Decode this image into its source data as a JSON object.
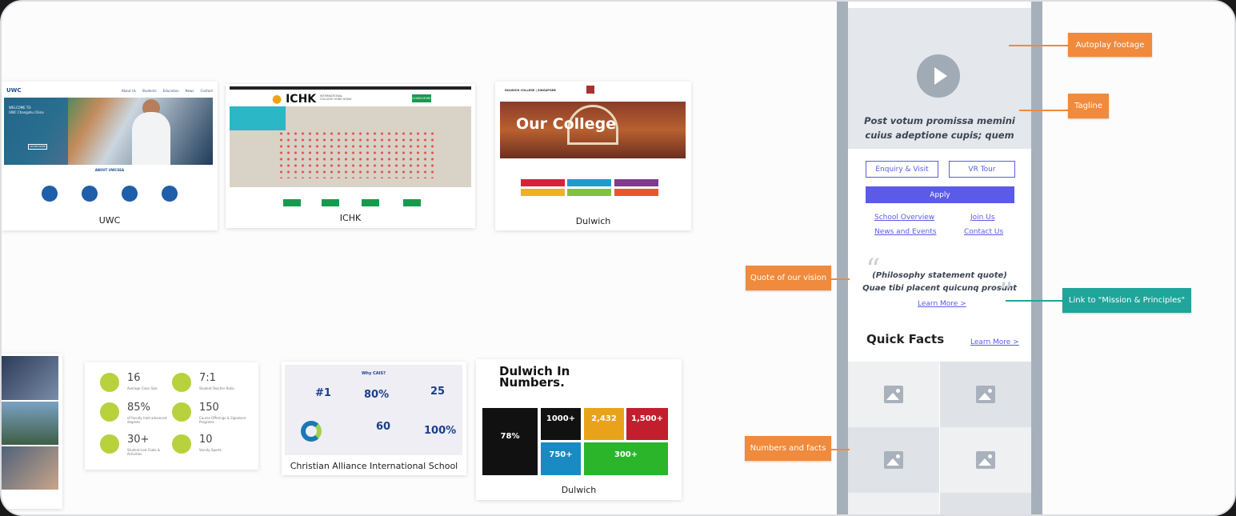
{
  "references": {
    "uwc": {
      "caption": "UWC",
      "logo": "UWC",
      "nav": [
        "About Us",
        "Students",
        "Education",
        "News",
        "Contact"
      ],
      "section": "ABOUT UWCSEA",
      "hero_text": "WELCOME TO\nUWC Changshu China",
      "hero_button": "LEARN MORE"
    },
    "ichk": {
      "caption": "ICHK",
      "logo": "ICHK",
      "logo_sub": "INTERNATIONAL COLLEGE HONG KONG",
      "button": "LEARN MORE"
    },
    "dulwich": {
      "caption": "Dulwich",
      "logo": "DULWICH COLLEGE | SINGAPORE",
      "hero_text": "Our College"
    },
    "facts": {
      "items": [
        {
          "value": "16",
          "label": "Average Class Size"
        },
        {
          "value": "7:1",
          "label": "Student-Teacher Ratio"
        },
        {
          "value": "85%",
          "label": "of faculty hold advanced degrees"
        },
        {
          "value": "150",
          "label": "Course Offerings & Signature Programs"
        },
        {
          "value": "30+",
          "label": "Student-Led Clubs & Activities"
        },
        {
          "value": "10",
          "label": "Varsity Sports"
        }
      ]
    },
    "christian": {
      "caption": "Christian Alliance International School",
      "heading": "Why CAIS?",
      "stats": [
        "#1",
        "80%",
        "25",
        "60",
        "100%"
      ]
    },
    "dulwich_numbers": {
      "caption": "Dulwich",
      "title": "Dulwich In Numbers.",
      "boxes": [
        "78%",
        "1000+",
        "2,432",
        "1,500+",
        "750+",
        "300+"
      ]
    }
  },
  "wireframe": {
    "tagline_line1": "Post votum promissa memini",
    "tagline_line2": "cuius adeptione cupis; quem",
    "enquiry": "Enquiry & Visit",
    "vr_tour": "VR Tour",
    "apply": "Apply",
    "links": [
      "School Overview",
      "Join Us",
      "News and Events",
      "Contact Us"
    ],
    "quote_line1": "(Philosophy statement quote)",
    "quote_line2": "Quae tibi placent quicunq prosunt",
    "learn_more": "Learn More >",
    "quick_facts": "Quick Facts",
    "facts_learn_more": "Learn More >"
  },
  "annotations": {
    "autoplay": "Autoplay footage",
    "tagline": "Tagline",
    "quote": "Quote of our vision",
    "mission_link": "Link to \"Mission & Principles\"",
    "numbers": "Numbers and facts"
  },
  "colors": {
    "accent": "#5b5be8",
    "annotation": "#f08a3c",
    "annotation_teal": "#1fa59a"
  }
}
